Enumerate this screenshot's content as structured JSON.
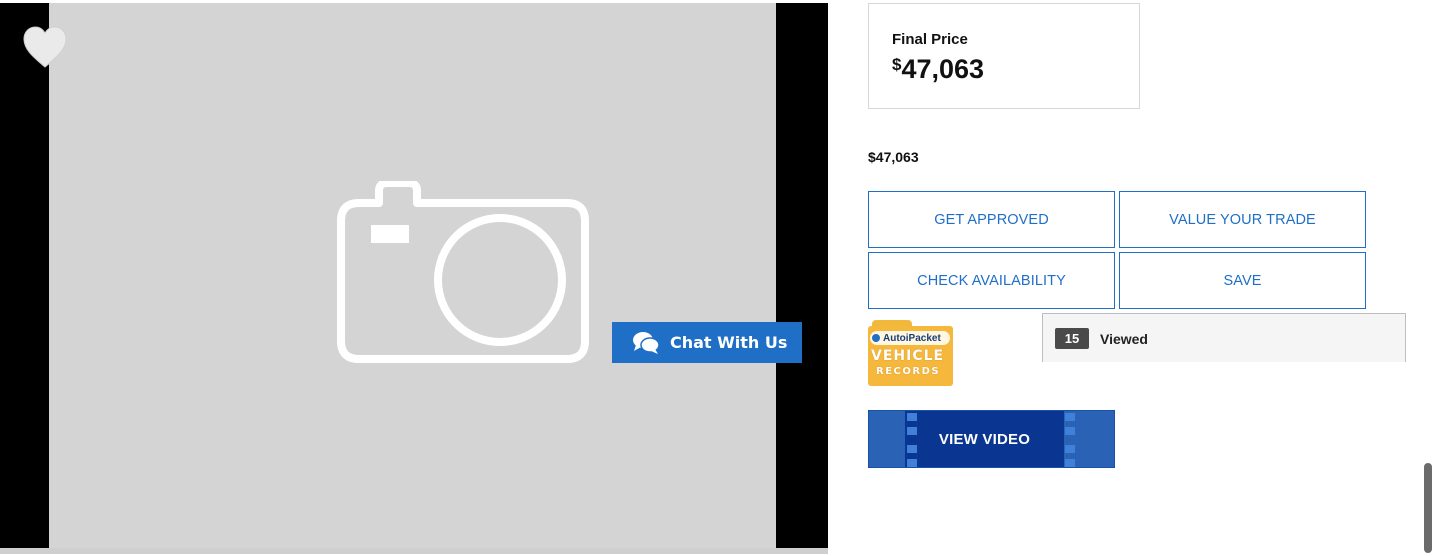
{
  "gallery": {
    "favorite_icon": "heart-icon",
    "placeholder_icon": "camera-icon"
  },
  "chat": {
    "label": "Chat With Us",
    "icon": "chat-bubbles-icon",
    "color": "#1f6fc7"
  },
  "pricing": {
    "final_label": "Final Price",
    "final_currency": "$",
    "final_amount": "47,063",
    "secondary_price": "$47,063"
  },
  "actions": [
    {
      "label": "GET APPROVED"
    },
    {
      "label": "VALUE YOUR TRADE"
    },
    {
      "label": "CHECK AVAILABILITY"
    },
    {
      "label": "SAVE"
    }
  ],
  "vehicle_records": {
    "brand": "AutoiPacket",
    "line1": "VEHICLE",
    "line2": "RECORDS"
  },
  "viewed": {
    "count": "15",
    "label": "Viewed"
  },
  "video": {
    "label": "VIEW VIDEO"
  },
  "colors": {
    "accent": "#1f6fc7",
    "video_bg": "#0a3c9c",
    "badge_yellow": "#f5b83d"
  }
}
